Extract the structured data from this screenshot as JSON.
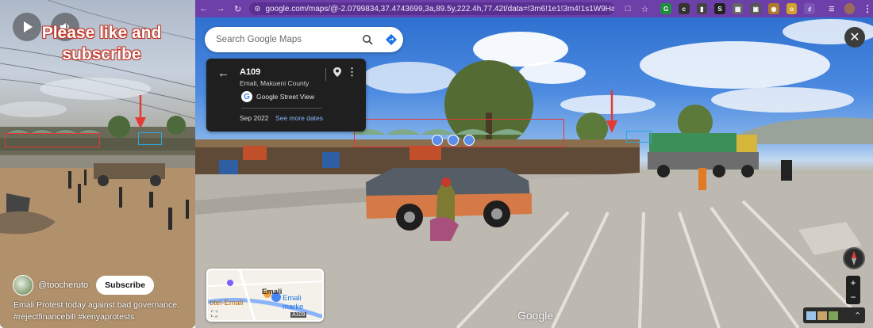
{
  "video": {
    "overlay_title": "Please like and subscribe",
    "handle": "@toocheruto",
    "subscribe_label": "Subscribe",
    "caption_line1": "Emali Protest today against bad governance.",
    "caption_line2": "#rejectfinancebill #kenyaprotests",
    "play_icon": "play-icon",
    "volume_icon": "volume-icon"
  },
  "browser": {
    "url": "google.com/maps/@-2.0799834,37.4743699,3a,89.5y,222.4h,77.42t/data=!3m6!1e1!3m4!1s1W9Ha...",
    "url_host": "google.com",
    "accent_color": "#6d3fa8"
  },
  "maps": {
    "search_placeholder": "Search Google Maps",
    "location_title": "A109",
    "location_subtitle": "Emali, Makueni County",
    "source_label": "Google Street View",
    "capture_date": "Sep 2022",
    "see_more_label": "See more dates",
    "watermark": "Google",
    "minimap": {
      "label_emali": "Emali",
      "label_market": "Emali marke",
      "label_hotel": "otel-Emali",
      "label_road": "A109"
    },
    "zoom_in": "+",
    "zoom_out": "−",
    "road_marking": "A109"
  }
}
